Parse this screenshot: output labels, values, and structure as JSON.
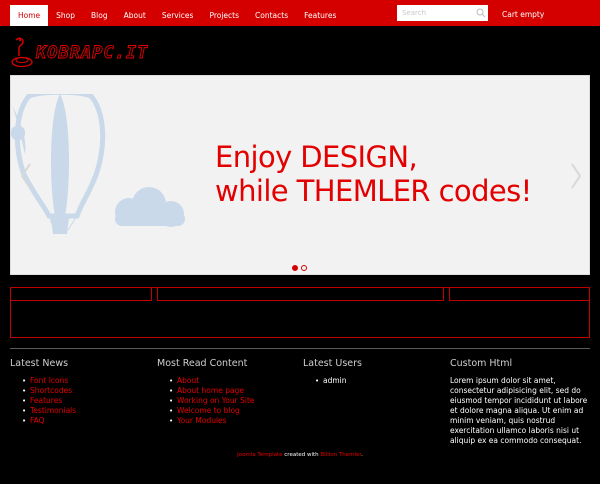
{
  "nav": {
    "items": [
      {
        "label": "Home",
        "active": true
      },
      {
        "label": "Shop"
      },
      {
        "label": "Blog"
      },
      {
        "label": "About"
      },
      {
        "label": "Services"
      },
      {
        "label": "Projects"
      },
      {
        "label": "Contacts"
      },
      {
        "label": "Features"
      }
    ],
    "search_placeholder": "Search",
    "cart_label": "Cart empty"
  },
  "logo": {
    "text": "KOBRAPC.IT"
  },
  "slider": {
    "line1": "Enjoy DESIGN,",
    "line2": "while THEMLER codes!",
    "slide_count": 2,
    "active_slide": 1
  },
  "columns": {
    "latest_news": {
      "title": "Latest News",
      "items": [
        "Font Icons",
        "Shortcodes",
        "Features",
        "Testimonials",
        "FAQ"
      ]
    },
    "most_read": {
      "title": "Most Read Content",
      "items": [
        "About",
        "About home page",
        "Working on Your Site",
        "Welcome to blog",
        "Your Modules"
      ]
    },
    "latest_users": {
      "title": "Latest Users",
      "items": [
        "admin"
      ]
    },
    "custom_html": {
      "title": "Custom Html",
      "text": "Lorem ipsum dolor sit amet, consectetur adipisicing elit, sed do eiusmod tempor incididunt ut labore et dolore magna aliqua. Ut enim ad minim veniam, quis nostrud exercitation ullamco laboris nisi ut aliquip ex ea commodo consequat."
    }
  },
  "footer": {
    "link1": "Joomla Template",
    "mid": " created with ",
    "link2": "Billion Themler",
    "end": "."
  },
  "colors": {
    "accent": "#d40000",
    "background": "#000000",
    "slider_bg": "#f2f2f2",
    "balloon": "#c9d9ea"
  }
}
